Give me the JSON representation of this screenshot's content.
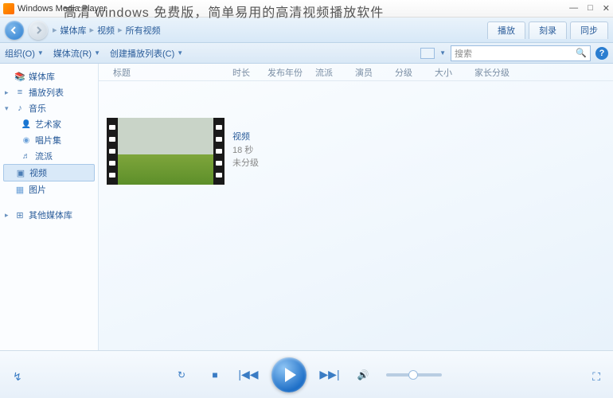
{
  "window": {
    "app_title": "Windows Media Player"
  },
  "overlay": "高清 windows 免费版，简单易用的高清视频播放软件",
  "breadcrumb": [
    "媒体库",
    "视频",
    "所有视频"
  ],
  "tabs": {
    "play": "播放",
    "burn": "刻录",
    "sync": "同步"
  },
  "toolbar": {
    "organize": "组织(O)",
    "stream": "媒体流(R)",
    "create_playlist": "创建播放列表(C)",
    "search_placeholder": "搜索"
  },
  "sidebar": {
    "library": "媒体库",
    "playlists": "播放列表",
    "music": "音乐",
    "artist": "艺术家",
    "album": "唱片集",
    "genre": "流派",
    "video": "视频",
    "pictures": "图片",
    "other": "其他媒体库"
  },
  "columns": {
    "title": "标题",
    "length": "时长",
    "year": "发布年份",
    "genre": "流派",
    "actors": "演员",
    "rating": "分级",
    "size": "大小",
    "parental": "家长分级"
  },
  "item": {
    "name": "视频",
    "duration": "18 秒",
    "rating": "未分级"
  }
}
